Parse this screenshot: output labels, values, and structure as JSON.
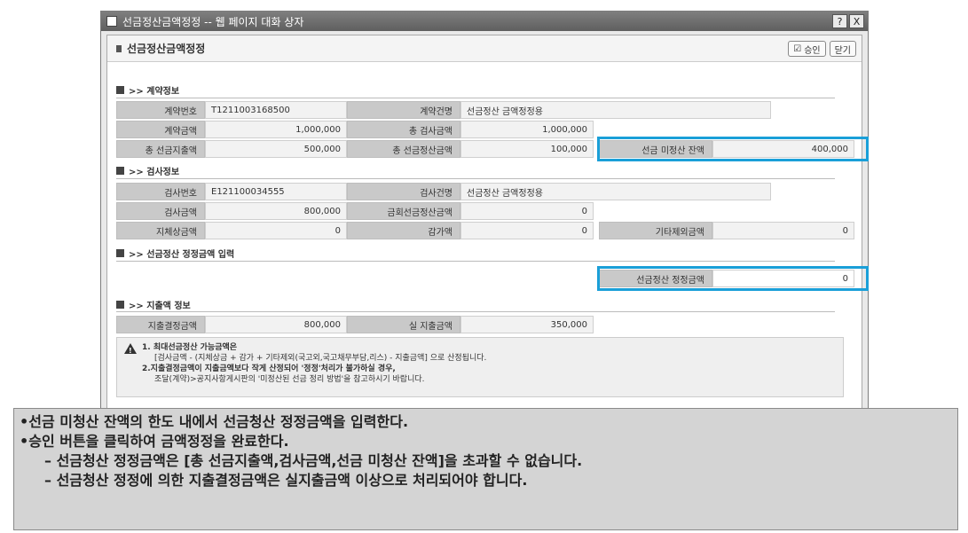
{
  "window": {
    "title": "선금정산금액정정 -- 웹 페이지 대화 상자",
    "help_button": "?",
    "close_button": "X"
  },
  "header": {
    "title": "선금정산금액정정",
    "approve_button": "승인",
    "close_button": "닫기"
  },
  "contract": {
    "section_title": ">> 계약정보",
    "contract_no_label": "계약번호",
    "contract_no": "T1211003168500",
    "contract_name_label": "계약건명",
    "contract_name": "선금정산 금액정정용",
    "contract_amount_label": "계약금액",
    "contract_amount": "1,000,000",
    "total_inspection_label": "총 검사금액",
    "total_inspection": "1,000,000",
    "total_advance_label": "총 선금지출액",
    "total_advance": "500,000",
    "total_settled_label": "총 선금정산금액",
    "total_settled": "100,000",
    "unsettled_label": "선금 미정산 잔액",
    "unsettled": "400,000"
  },
  "inspection": {
    "section_title": ">> 검사정보",
    "inspection_no_label": "검사번호",
    "inspection_no": "E121100034555",
    "inspection_name_label": "검사건명",
    "inspection_name": "선금정산 금액정정용",
    "inspection_amount_label": "검사금액",
    "inspection_amount": "800,000",
    "current_advance_label": "금회선금정산금액",
    "current_advance": "0",
    "delay_label": "지체상금액",
    "delay": "0",
    "deduction_label": "감가액",
    "deduction": "0",
    "other_label": "기타제외금액",
    "other": "0"
  },
  "correction": {
    "section_title": ">> 선금정산 정정금액 입력",
    "label": "선금정산 정정금액",
    "value": "0"
  },
  "payment": {
    "section_title": ">> 지출액 정보",
    "decided_label": "지출결정금액",
    "decided": "800,000",
    "actual_label": "실 지출금액",
    "actual": "350,000"
  },
  "warning": {
    "line1": "1. 최대선금정산 가능금액은",
    "line2": "[검사금액 - (지체상금 + 감가 + 기타제외(국고외,국고채무부담,리스) - 지출금액] 으로 산정됩니다.",
    "line3": "2.지출결정금액이 지출금액보다 작게 산정되어 '정정'처리가 불가하실 경우,",
    "line4": "조달(계약)>공지사항게시판의 '미정산된 선금 정리 방법'을 참고하시기 바랍니다."
  },
  "note": {
    "line1": "•선금 미청산 잔액의 한도 내에서 선금청산 정정금액을 입력한다.",
    "line2": "•승인 버튼을 클릭하여 금액정정을 완료한다.",
    "line3": "– 선금청산 정정금액은 [총 선금지출액,검사금액,선금 미청산 잔액]을 초과할 수 없습니다.",
    "line4": "– 선금청산 정정에 의한 지출결정금액은 실지출금액 이상으로 처리되어야 합니다."
  },
  "colors": {
    "highlight": "#1a9fd8",
    "title_bar": "#6a6a6a"
  }
}
